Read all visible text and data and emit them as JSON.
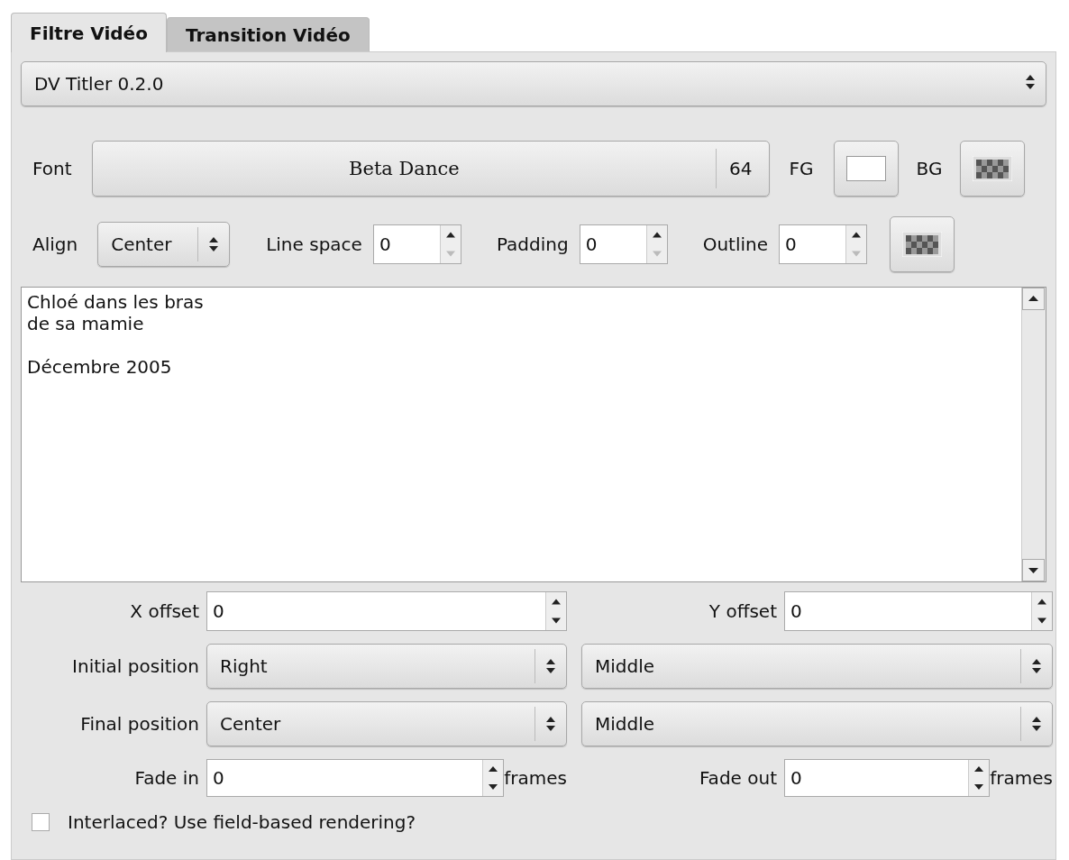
{
  "tabs": [
    {
      "label": "Filtre Vidéo",
      "selected": true
    },
    {
      "label": "Transition Vidéo",
      "selected": false
    }
  ],
  "effect_select": {
    "value": "DV Titler 0.2.0"
  },
  "font": {
    "label": "Font",
    "name": "Beta Dance",
    "size": "64"
  },
  "fg_label": "FG",
  "bg_label": "BG",
  "align": {
    "label": "Align",
    "value": "Center"
  },
  "spins": [
    {
      "label": "Line space",
      "value": "0",
      "decrement_disabled": true
    },
    {
      "label": "Padding",
      "value": "0",
      "decrement_disabled": true
    },
    {
      "label": "Outline",
      "value": "0",
      "decrement_disabled": true
    }
  ],
  "text": "Chloé dans les bras\nde sa mamie\n\nDécembre 2005",
  "offsets": [
    {
      "label": "X offset",
      "value": "0",
      "decrement_disabled": false
    },
    {
      "label": "Y offset",
      "value": "0",
      "decrement_disabled": false
    }
  ],
  "positions": [
    {
      "label": "Initial position",
      "horizontal": "Right",
      "vertical": "Middle"
    },
    {
      "label": "Final position",
      "horizontal": "Center",
      "vertical": "Middle"
    }
  ],
  "fades": [
    {
      "label": "Fade in",
      "value": "0",
      "unit": "frames",
      "decrement_disabled": false
    },
    {
      "label": "Fade out",
      "value": "0",
      "unit": "frames",
      "decrement_disabled": false
    }
  ],
  "interlace": {
    "label": "Interlaced? Use field-based rendering?",
    "checked": false
  }
}
